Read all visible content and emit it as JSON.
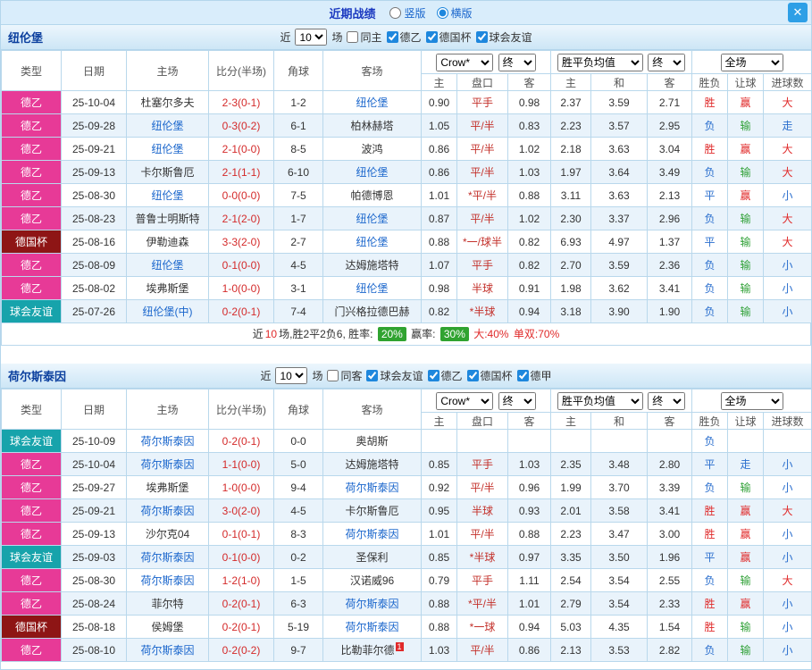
{
  "topbar": {
    "title": "近期战绩",
    "layout_options": [
      {
        "label": "竖版",
        "selected": false
      },
      {
        "label": "横版",
        "selected": true
      }
    ],
    "close_glyph": "✕"
  },
  "palette": {
    "red": "#e02a2a",
    "blue": "#2b6fce",
    "green": "#2fa036",
    "accent_blue": "#2e9fe6"
  },
  "league_styles": [
    {
      "label": "德乙",
      "key": "lg-de2",
      "color": "#e73a97"
    },
    {
      "label": "德国杯",
      "key": "lg-cup",
      "color": "#8e1515"
    },
    {
      "label": "球会友谊",
      "key": "lg-fri",
      "color": "#17a3ab"
    },
    {
      "label": "德甲",
      "key": "lg-de1",
      "color": "#3b9e3b"
    }
  ],
  "sections": [
    {
      "team": "纽伦堡",
      "filter": {
        "near": "近",
        "count": "10",
        "unit": "场",
        "checks": [
          {
            "label": "同主",
            "checked": false
          },
          {
            "label": "德乙",
            "checked": true
          },
          {
            "label": "德国杯",
            "checked": true
          },
          {
            "label": "球会友谊",
            "checked": true
          }
        ]
      },
      "header": {
        "type": "类型",
        "date": "日期",
        "home": "主场",
        "score": "比分(半场)",
        "corner": "角球",
        "away": "客场",
        "odds_source": "Crow*",
        "odds_final": "终",
        "avg_label": "胜平负均值",
        "avg_final": "终",
        "scope": "全场",
        "sub": [
          "主",
          "盘口",
          "客",
          "主",
          "和",
          "客",
          "胜负",
          "让球",
          "进球数"
        ]
      },
      "rows": [
        {
          "league": "德乙",
          "date": "25-10-04",
          "home": "杜塞尔多夫",
          "home_focus": false,
          "score": "2-3(0-1)",
          "corner": "1-2",
          "away": "纽伦堡",
          "away_focus": true,
          "odds": [
            "0.90",
            "平手",
            "0.98"
          ],
          "avg": [
            "2.37",
            "3.59",
            "2.71"
          ],
          "res": [
            "胜",
            "r"
          ],
          "let": [
            "赢",
            "r"
          ],
          "goal": [
            "大",
            "r"
          ]
        },
        {
          "league": "德乙",
          "date": "25-09-28",
          "home": "纽伦堡",
          "home_focus": true,
          "score": "0-3(0-2)",
          "corner": "6-1",
          "away": "柏林赫塔",
          "away_focus": false,
          "odds": [
            "1.05",
            "平/半",
            "0.83"
          ],
          "avg": [
            "2.23",
            "3.57",
            "2.95"
          ],
          "res": [
            "负",
            "b"
          ],
          "let": [
            "输",
            "g"
          ],
          "goal": [
            "走",
            "b"
          ]
        },
        {
          "league": "德乙",
          "date": "25-09-21",
          "home": "纽伦堡",
          "home_focus": true,
          "score": "2-1(0-0)",
          "corner": "8-5",
          "away": "波鸿",
          "away_focus": false,
          "odds": [
            "0.86",
            "平/半",
            "1.02"
          ],
          "avg": [
            "2.18",
            "3.63",
            "3.04"
          ],
          "res": [
            "胜",
            "r"
          ],
          "let": [
            "赢",
            "r"
          ],
          "goal": [
            "大",
            "r"
          ]
        },
        {
          "league": "德乙",
          "date": "25-09-13",
          "home": "卡尔斯鲁厄",
          "home_focus": false,
          "score": "2-1(1-1)",
          "corner": "6-10",
          "away": "纽伦堡",
          "away_focus": true,
          "odds": [
            "0.86",
            "平/半",
            "1.03"
          ],
          "avg": [
            "1.97",
            "3.64",
            "3.49"
          ],
          "res": [
            "负",
            "b"
          ],
          "let": [
            "输",
            "g"
          ],
          "goal": [
            "大",
            "r"
          ]
        },
        {
          "league": "德乙",
          "date": "25-08-30",
          "home": "纽伦堡",
          "home_focus": true,
          "score": "0-0(0-0)",
          "corner": "7-5",
          "away": "帕德博恩",
          "away_focus": false,
          "odds": [
            "1.01",
            "*平/半",
            "0.88"
          ],
          "avg": [
            "3.11",
            "3.63",
            "2.13"
          ],
          "res": [
            "平",
            "b"
          ],
          "let": [
            "赢",
            "r"
          ],
          "goal": [
            "小",
            "b"
          ]
        },
        {
          "league": "德乙",
          "date": "25-08-23",
          "home": "普鲁士明斯特",
          "home_focus": false,
          "score": "2-1(2-0)",
          "corner": "1-7",
          "away": "纽伦堡",
          "away_focus": true,
          "odds": [
            "0.87",
            "平/半",
            "1.02"
          ],
          "avg": [
            "2.30",
            "3.37",
            "2.96"
          ],
          "res": [
            "负",
            "b"
          ],
          "let": [
            "输",
            "g"
          ],
          "goal": [
            "大",
            "r"
          ]
        },
        {
          "league": "德国杯",
          "date": "25-08-16",
          "home": "伊勒迪森",
          "home_focus": false,
          "score": "3-3(2-0)",
          "corner": "2-7",
          "away": "纽伦堡",
          "away_focus": true,
          "odds": [
            "0.88",
            "*一/球半",
            "0.82"
          ],
          "avg": [
            "6.93",
            "4.97",
            "1.37"
          ],
          "res": [
            "平",
            "b"
          ],
          "let": [
            "输",
            "g"
          ],
          "goal": [
            "大",
            "r"
          ]
        },
        {
          "league": "德乙",
          "date": "25-08-09",
          "home": "纽伦堡",
          "home_focus": true,
          "score": "0-1(0-0)",
          "corner": "4-5",
          "away": "达姆施塔特",
          "away_focus": false,
          "odds": [
            "1.07",
            "平手",
            "0.82"
          ],
          "avg": [
            "2.70",
            "3.59",
            "2.36"
          ],
          "res": [
            "负",
            "b"
          ],
          "let": [
            "输",
            "g"
          ],
          "goal": [
            "小",
            "b"
          ]
        },
        {
          "league": "德乙",
          "date": "25-08-02",
          "home": "埃弗斯堡",
          "home_focus": false,
          "score": "1-0(0-0)",
          "corner": "3-1",
          "away": "纽伦堡",
          "away_focus": true,
          "odds": [
            "0.98",
            "半球",
            "0.91"
          ],
          "avg": [
            "1.98",
            "3.62",
            "3.41"
          ],
          "res": [
            "负",
            "b"
          ],
          "let": [
            "输",
            "g"
          ],
          "goal": [
            "小",
            "b"
          ]
        },
        {
          "league": "球会友谊",
          "date": "25-07-26",
          "home": "纽伦堡(中)",
          "home_focus": true,
          "score": "0-2(0-1)",
          "corner": "7-4",
          "away": "门兴格拉德巴赫",
          "away_focus": false,
          "odds": [
            "0.82",
            "*半球",
            "0.94"
          ],
          "avg": [
            "3.18",
            "3.90",
            "1.90"
          ],
          "res": [
            "负",
            "b"
          ],
          "let": [
            "输",
            "g"
          ],
          "goal": [
            "小",
            "b"
          ]
        }
      ],
      "summary": [
        {
          "text": "近",
          "style": "plain"
        },
        {
          "text": "10",
          "style": "red"
        },
        {
          "text": "场,胜2平2负6, 胜率: ",
          "style": "plain"
        },
        {
          "text": "20%",
          "style": "badge"
        },
        {
          "text": " 赢率: ",
          "style": "plain"
        },
        {
          "text": "30%",
          "style": "badge"
        },
        {
          "text": " 大:40%",
          "style": "red"
        },
        {
          "text": " 单双:70%",
          "style": "red"
        }
      ]
    },
    {
      "team": "荷尔斯泰因",
      "filter": {
        "near": "近",
        "count": "10",
        "unit": "场",
        "checks": [
          {
            "label": "同客",
            "checked": false
          },
          {
            "label": "球会友谊",
            "checked": true
          },
          {
            "label": "德乙",
            "checked": true
          },
          {
            "label": "德国杯",
            "checked": true
          },
          {
            "label": "德甲",
            "checked": true
          }
        ]
      },
      "header": {
        "type": "类型",
        "date": "日期",
        "home": "主场",
        "score": "比分(半场)",
        "corner": "角球",
        "away": "客场",
        "odds_source": "Crow*",
        "odds_final": "终",
        "avg_label": "胜平负均值",
        "avg_final": "终",
        "scope": "全场",
        "sub": [
          "主",
          "盘口",
          "客",
          "主",
          "和",
          "客",
          "胜负",
          "让球",
          "进球数"
        ]
      },
      "rows": [
        {
          "league": "球会友谊",
          "date": "25-10-09",
          "home": "荷尔斯泰因",
          "home_focus": true,
          "score": "0-2(0-1)",
          "corner": "0-0",
          "away": "奥胡斯",
          "away_focus": false,
          "odds": [
            "",
            "",
            ""
          ],
          "avg": [
            "",
            "",
            ""
          ],
          "res": [
            "负",
            "b"
          ],
          "let": [
            "",
            ""
          ],
          "goal": [
            "",
            ""
          ]
        },
        {
          "league": "德乙",
          "date": "25-10-04",
          "home": "荷尔斯泰因",
          "home_focus": true,
          "score": "1-1(0-0)",
          "corner": "5-0",
          "away": "达姆施塔特",
          "away_focus": false,
          "odds": [
            "0.85",
            "平手",
            "1.03"
          ],
          "avg": [
            "2.35",
            "3.48",
            "2.80"
          ],
          "res": [
            "平",
            "b"
          ],
          "let": [
            "走",
            "b"
          ],
          "goal": [
            "小",
            "b"
          ]
        },
        {
          "league": "德乙",
          "date": "25-09-27",
          "home": "埃弗斯堡",
          "home_focus": false,
          "score": "1-0(0-0)",
          "corner": "9-4",
          "away": "荷尔斯泰因",
          "away_focus": true,
          "odds": [
            "0.92",
            "平/半",
            "0.96"
          ],
          "avg": [
            "1.99",
            "3.70",
            "3.39"
          ],
          "res": [
            "负",
            "b"
          ],
          "let": [
            "输",
            "g"
          ],
          "goal": [
            "小",
            "b"
          ]
        },
        {
          "league": "德乙",
          "date": "25-09-21",
          "home": "荷尔斯泰因",
          "home_focus": true,
          "score": "3-0(2-0)",
          "corner": "4-5",
          "away": "卡尔斯鲁厄",
          "away_focus": false,
          "odds": [
            "0.95",
            "半球",
            "0.93"
          ],
          "avg": [
            "2.01",
            "3.58",
            "3.41"
          ],
          "res": [
            "胜",
            "r"
          ],
          "let": [
            "赢",
            "r"
          ],
          "goal": [
            "大",
            "r"
          ]
        },
        {
          "league": "德乙",
          "date": "25-09-13",
          "home": "沙尔克04",
          "home_focus": false,
          "score": "0-1(0-1)",
          "corner": "8-3",
          "away": "荷尔斯泰因",
          "away_focus": true,
          "odds": [
            "1.01",
            "平/半",
            "0.88"
          ],
          "avg": [
            "2.23",
            "3.47",
            "3.00"
          ],
          "res": [
            "胜",
            "r"
          ],
          "let": [
            "赢",
            "r"
          ],
          "goal": [
            "小",
            "b"
          ]
        },
        {
          "league": "球会友谊",
          "date": "25-09-03",
          "home": "荷尔斯泰因",
          "home_focus": true,
          "score": "0-1(0-0)",
          "corner": "0-2",
          "away": "圣保利",
          "away_focus": false,
          "odds": [
            "0.85",
            "*半球",
            "0.97"
          ],
          "avg": [
            "3.35",
            "3.50",
            "1.96"
          ],
          "res": [
            "平",
            "b"
          ],
          "let": [
            "赢",
            "r"
          ],
          "goal": [
            "小",
            "b"
          ]
        },
        {
          "league": "德乙",
          "date": "25-08-30",
          "home": "荷尔斯泰因",
          "home_focus": true,
          "score": "1-2(1-0)",
          "corner": "1-5",
          "away": "汉诺威96",
          "away_focus": false,
          "odds": [
            "0.79",
            "平手",
            "1.11"
          ],
          "avg": [
            "2.54",
            "3.54",
            "2.55"
          ],
          "res": [
            "负",
            "b"
          ],
          "let": [
            "输",
            "g"
          ],
          "goal": [
            "大",
            "r"
          ]
        },
        {
          "league": "德乙",
          "date": "25-08-24",
          "home": "菲尔特",
          "home_focus": false,
          "score": "0-2(0-1)",
          "corner": "6-3",
          "away": "荷尔斯泰因",
          "away_focus": true,
          "odds": [
            "0.88",
            "*平/半",
            "1.01"
          ],
          "avg": [
            "2.79",
            "3.54",
            "2.33"
          ],
          "res": [
            "胜",
            "r"
          ],
          "let": [
            "赢",
            "r"
          ],
          "goal": [
            "小",
            "b"
          ]
        },
        {
          "league": "德国杯",
          "date": "25-08-18",
          "home": "侯姆堡",
          "home_focus": false,
          "score": "0-2(0-1)",
          "corner": "5-19",
          "away": "荷尔斯泰因",
          "away_focus": true,
          "odds": [
            "0.88",
            "*一球",
            "0.94"
          ],
          "avg": [
            "5.03",
            "4.35",
            "1.54"
          ],
          "res": [
            "胜",
            "r"
          ],
          "let": [
            "输",
            "g"
          ],
          "goal": [
            "小",
            "b"
          ]
        },
        {
          "league": "德乙",
          "date": "25-08-10",
          "home": "荷尔斯泰因",
          "home_focus": true,
          "score": "0-2(0-2)",
          "corner": "9-7",
          "away": "比勒菲尔德",
          "away_focus": false,
          "away_badge": "1",
          "odds": [
            "1.03",
            "平/半",
            "0.86"
          ],
          "avg": [
            "2.13",
            "3.53",
            "2.82"
          ],
          "res": [
            "负",
            "b"
          ],
          "let": [
            "输",
            "g"
          ],
          "goal": [
            "小",
            "b"
          ]
        }
      ]
    }
  ]
}
